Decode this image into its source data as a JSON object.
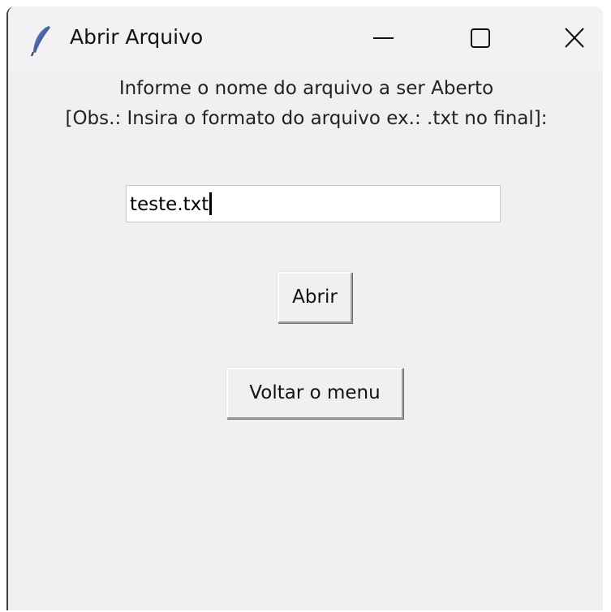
{
  "window": {
    "title": "Abrir Arquivo",
    "icon": "feather-icon",
    "controls": {
      "minimize_icon": "minimize-icon",
      "maximize_icon": "maximize-icon",
      "close_icon": "close-icon"
    }
  },
  "form": {
    "instruction_line1": "Informe o nome do arquivo a ser Aberto",
    "instruction_line2": "[Obs.: Insira o formato do arquivo ex.: .txt no final]:",
    "filename_value": "teste.txt",
    "open_button_label": "Abrir",
    "back_button_label": "Voltar o menu"
  },
  "colors": {
    "window_background": "#f0f0f0",
    "titlebar_background": "#f3f1f3",
    "entry_background": "#ffffff"
  }
}
